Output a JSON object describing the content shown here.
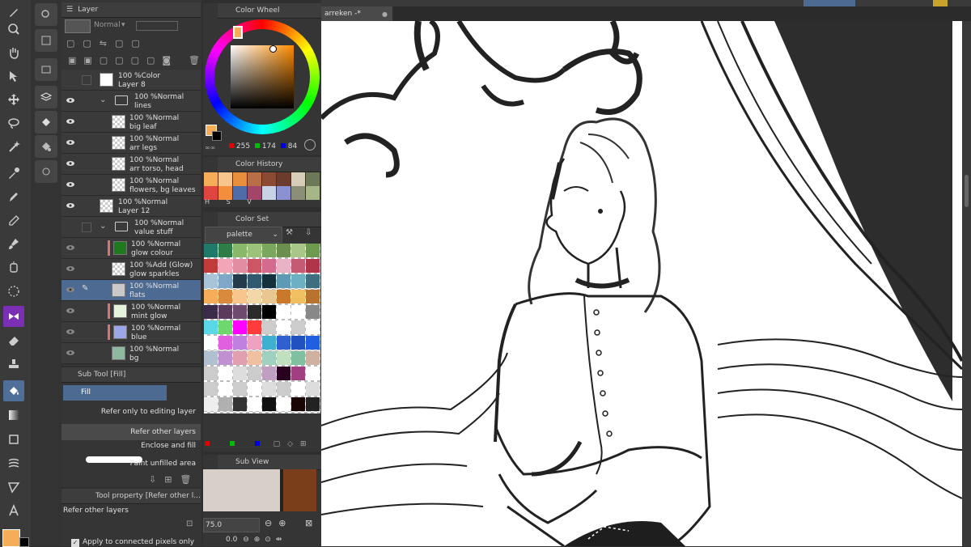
{
  "colors": {
    "accent": "#4d6a92",
    "main_color": "#f5ad5a",
    "bg_dark": "#2f2f2f"
  },
  "panels": {
    "layer_title": "Layer",
    "color_wheel_title": "Color Wheel",
    "color_history_title": "Color History",
    "color_set_title": "Color Set",
    "sub_view_title": "Sub View",
    "sub_tool_title": "Sub Tool [Fill]",
    "tool_property_title": "Tool property [Refer other l..."
  },
  "layer_panel": {
    "blend_mode": "Normal",
    "layers": [
      {
        "opacity": "100 %",
        "mode": "Color",
        "name": "Layer 8"
      },
      {
        "opacity": "100 %",
        "mode": "Normal",
        "name": "lines"
      },
      {
        "opacity": "100 %",
        "mode": "Normal",
        "name": "big leaf"
      },
      {
        "opacity": "100 %",
        "mode": "Normal",
        "name": "arr legs"
      },
      {
        "opacity": "100 %",
        "mode": "Normal",
        "name": "arr torso, head"
      },
      {
        "opacity": "100 %",
        "mode": "Normal",
        "name": "flowers, bg leaves"
      },
      {
        "opacity": "100 %",
        "mode": "Normal",
        "name": "Layer 12"
      },
      {
        "opacity": "100 %",
        "mode": "Normal",
        "name": "value stuff"
      },
      {
        "opacity": "100 %",
        "mode": "Normal",
        "name": "glow colour"
      },
      {
        "opacity": "100 %",
        "mode": "Add (Glow)",
        "name": "glow sparkles"
      },
      {
        "opacity": "100 %",
        "mode": "Normal",
        "name": "flats"
      },
      {
        "opacity": "100 %",
        "mode": "Normal",
        "name": "mint glow"
      },
      {
        "opacity": "100 %",
        "mode": "Normal",
        "name": "blue"
      },
      {
        "opacity": "100 %",
        "mode": "Normal",
        "name": "bg"
      }
    ]
  },
  "color_wheel": {
    "r": "255",
    "g": "174",
    "b": "84"
  },
  "color_history": {
    "labels": [
      "H",
      "S",
      "V"
    ]
  },
  "color_set": {
    "palette": "palette"
  },
  "sub_view": {
    "zoom": "75.0",
    "rotation": "0.0"
  },
  "sub_tool": {
    "active": "Fill",
    "items": [
      "Refer only to editing layer",
      "Refer other layers",
      "Enclose and fill",
      "Paint unfilled area"
    ]
  },
  "tool_property": {
    "heading": "Refer other layers",
    "option": "Apply to connected pixels only"
  },
  "document": {
    "tab": "arreken -*"
  },
  "icons": [
    "pen-icon",
    "search-icon",
    "hand-icon",
    "move-icon",
    "lasso-icon",
    "wand-icon",
    "eyedropper-icon",
    "pencil-icon",
    "brush-icon",
    "eraser-icon",
    "fill-icon",
    "gradient-icon",
    "shape-icon",
    "text-icon",
    "eye-icon",
    "folder-icon",
    "trash-icon"
  ]
}
